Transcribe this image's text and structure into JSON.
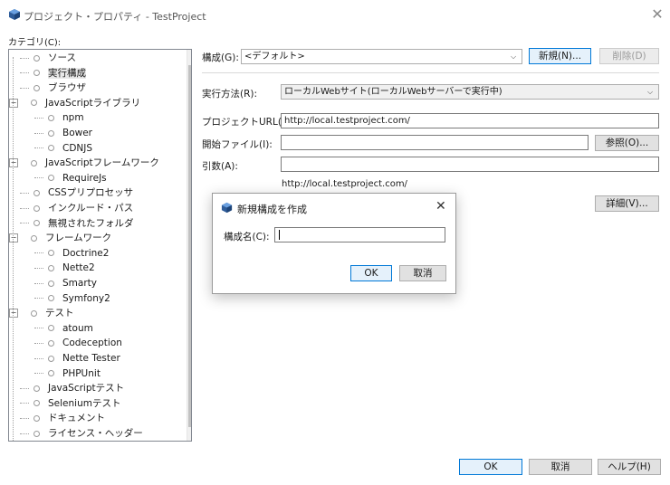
{
  "window": {
    "title": "プロジェクト・プロパティ - TestProject",
    "close_symbol": "✕"
  },
  "categories": {
    "label": "カテゴリ(C):",
    "items": [
      {
        "label": "ソース",
        "level": 0,
        "expander": ""
      },
      {
        "label": "実行構成",
        "level": 0,
        "expander": "",
        "selected": true
      },
      {
        "label": "ブラウザ",
        "level": 0,
        "expander": ""
      },
      {
        "label": "JavaScriptライブラリ",
        "level": 0,
        "expander": "−"
      },
      {
        "label": "npm",
        "level": 1,
        "expander": ""
      },
      {
        "label": "Bower",
        "level": 1,
        "expander": ""
      },
      {
        "label": "CDNJS",
        "level": 1,
        "expander": ""
      },
      {
        "label": "JavaScriptフレームワーク",
        "level": 0,
        "expander": "−"
      },
      {
        "label": "RequireJs",
        "level": 1,
        "expander": ""
      },
      {
        "label": "CSSプリプロセッサ",
        "level": 0,
        "expander": ""
      },
      {
        "label": "インクルード・パス",
        "level": 0,
        "expander": ""
      },
      {
        "label": "無視されたフォルダ",
        "level": 0,
        "expander": ""
      },
      {
        "label": "フレームワーク",
        "level": 0,
        "expander": "−"
      },
      {
        "label": "Doctrine2",
        "level": 1,
        "expander": ""
      },
      {
        "label": "Nette2",
        "level": 1,
        "expander": ""
      },
      {
        "label": "Smarty",
        "level": 1,
        "expander": ""
      },
      {
        "label": "Symfony2",
        "level": 1,
        "expander": ""
      },
      {
        "label": "テスト",
        "level": 0,
        "expander": "−"
      },
      {
        "label": "atoum",
        "level": 1,
        "expander": ""
      },
      {
        "label": "Codeception",
        "level": 1,
        "expander": ""
      },
      {
        "label": "Nette Tester",
        "level": 1,
        "expander": ""
      },
      {
        "label": "PHPUnit",
        "level": 1,
        "expander": ""
      },
      {
        "label": "JavaScriptテスト",
        "level": 0,
        "expander": ""
      },
      {
        "label": "Seleniumテスト",
        "level": 0,
        "expander": ""
      },
      {
        "label": "ドキュメント",
        "level": 0,
        "expander": ""
      },
      {
        "label": "ライセンス・ヘッダー",
        "level": 0,
        "expander": ""
      }
    ]
  },
  "config": {
    "label": "構成(G):",
    "value": "<デフォルト>",
    "new_button": "新規(N)...",
    "delete_button": "削除(D)"
  },
  "run": {
    "method_label": "実行方法(R):",
    "method_value": "ローカルWebサイト(ローカルWebサーバーで実行中)",
    "url_label": "プロジェクトURL(U):",
    "url_value": "http://local.testproject.com/",
    "start_label": "開始ファイル(I):",
    "start_value": "",
    "browse_button": "参照(O)...",
    "args_label": "引数(A):",
    "args_value": "",
    "preview_url": "http://local.testproject.com/",
    "details_button": "詳細(V)..."
  },
  "dialog": {
    "title": "新規構成を作成",
    "close_symbol": "✕",
    "name_label": "構成名(C):",
    "name_value": "",
    "ok_button": "OK",
    "cancel_button": "取消"
  },
  "footer": {
    "ok_button": "OK",
    "cancel_button": "取消",
    "help_button": "ヘルプ(H)"
  },
  "icons": {
    "app": "netbeans-cube-icon",
    "scroll_up": "▲",
    "scroll_down": "▼",
    "combo": "⌵"
  },
  "colors": {
    "accent": "#0078d7",
    "selection": "#e8e8e8"
  }
}
